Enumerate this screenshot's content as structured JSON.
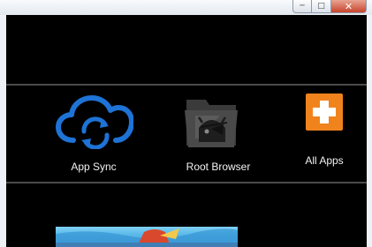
{
  "window": {
    "controls": {
      "minimize": "─",
      "maximize": "□",
      "close": "✕"
    }
  },
  "apps": [
    {
      "label": "App Sync",
      "icon": "cloud-sync-icon"
    },
    {
      "label": "Root Browser",
      "icon": "root-browser-icon"
    },
    {
      "label": "All Apps",
      "icon": "all-apps-plus-icon"
    }
  ],
  "colors": {
    "screen_bg": "#000000",
    "sync_blue": "#1e73d6",
    "plus_orange": "#f0831c",
    "label_text": "#f2f2f2"
  }
}
